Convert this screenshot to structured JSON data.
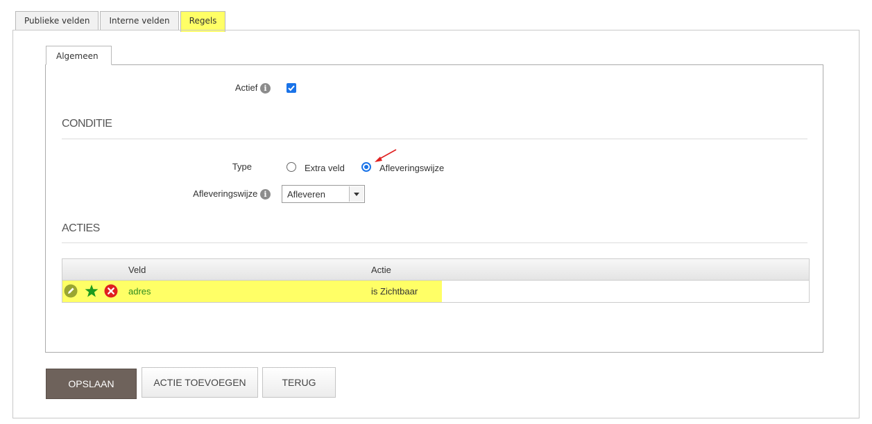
{
  "outer_tabs": [
    {
      "label": "Publieke velden",
      "active": false
    },
    {
      "label": "Interne velden",
      "active": false
    },
    {
      "label": "Regels",
      "active": true
    }
  ],
  "inner_tab": {
    "label": "Algemeen"
  },
  "form": {
    "actief_label": "Actief",
    "actief_checked": true,
    "info_glyph": "i",
    "conditie_title": "CONDITIE",
    "type_label": "Type",
    "type_options": [
      {
        "label": "Extra veld",
        "selected": false
      },
      {
        "label": "Afleveringswijze",
        "selected": true
      }
    ],
    "afleveringswijze_label": "Afleveringswijze",
    "afleveringswijze_value": "Afleveren",
    "acties_title": "ACTIES"
  },
  "table": {
    "columns": [
      "Veld",
      "Actie"
    ],
    "rows": [
      {
        "veld": "adres",
        "actie": "is Zichtbaar",
        "icons": [
          "edit-icon",
          "star-icon",
          "delete-icon"
        ]
      }
    ]
  },
  "buttons": {
    "save": "OPSLAAN",
    "add_action": "ACTIE TOEVOEGEN",
    "back": "TERUG"
  },
  "colors": {
    "highlight": "#ffff66",
    "accent_blue": "#1a73e8",
    "save_button": "#6e625b",
    "green_text": "#2e8b1e",
    "annotation_arrow": "#e02020"
  }
}
